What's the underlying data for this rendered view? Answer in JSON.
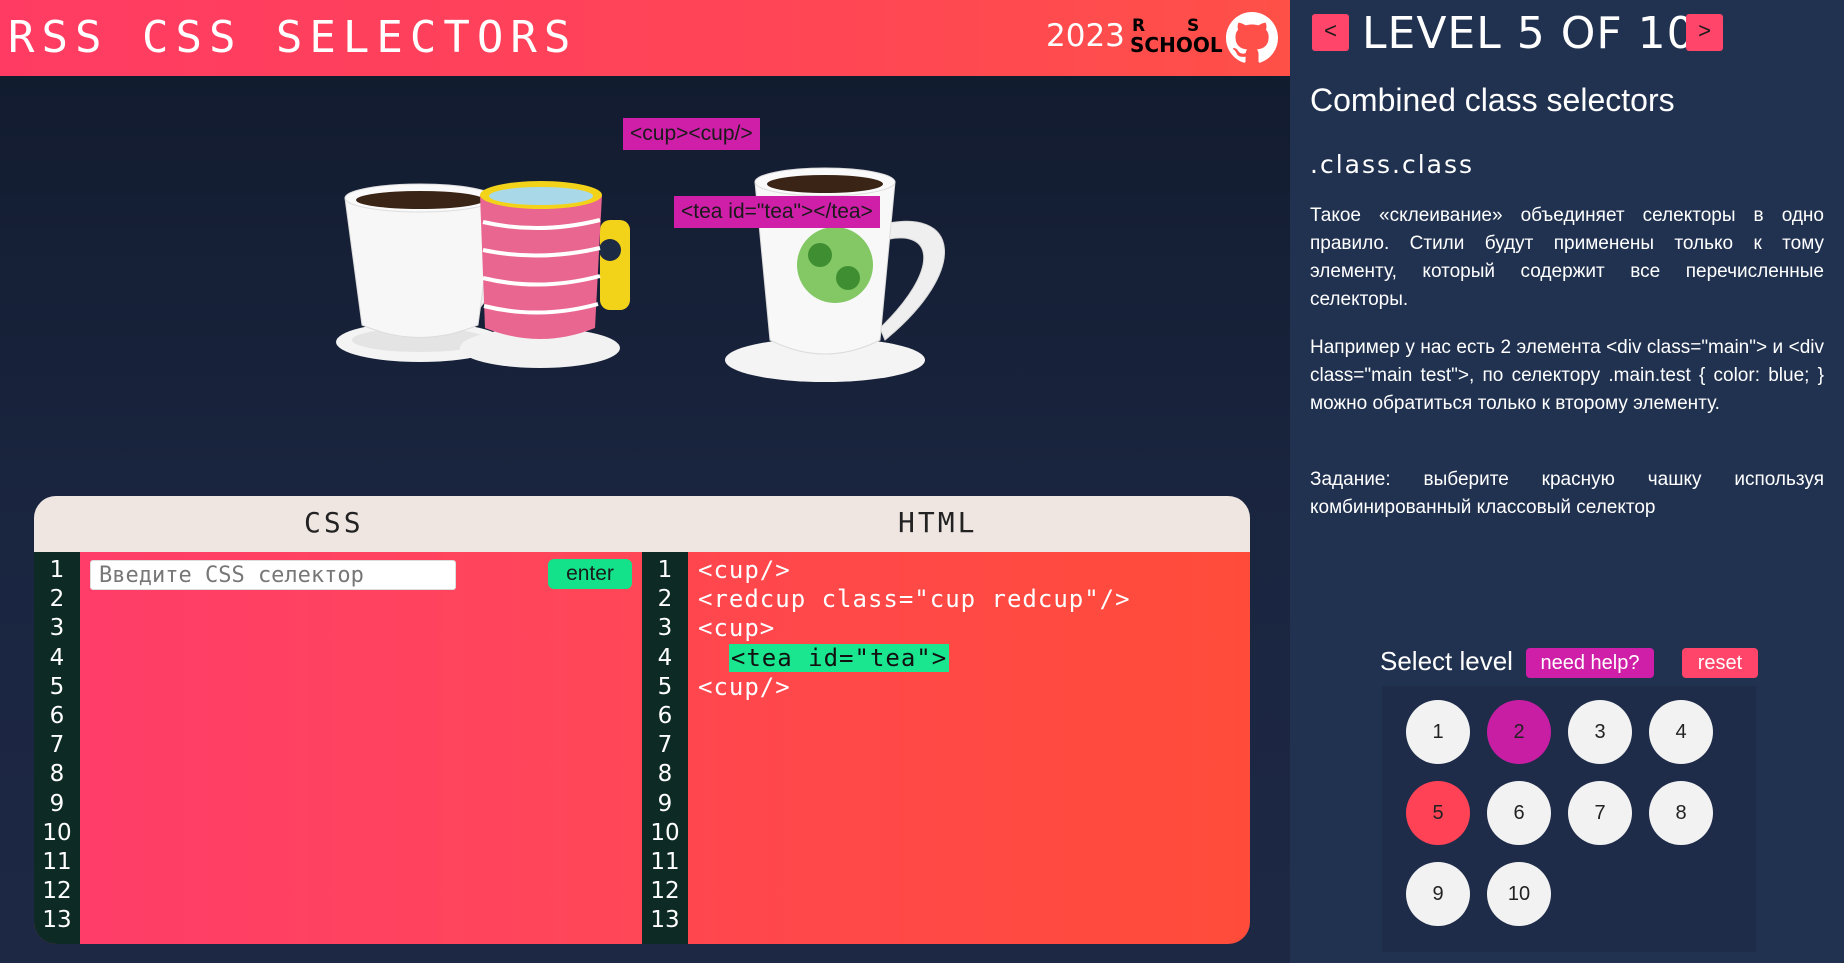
{
  "header": {
    "title": "RSS CSS SELECTORS",
    "year": "2023",
    "logo": {
      "top": "R S",
      "bottom": "SCHOOL"
    }
  },
  "scene": {
    "labels": [
      "<cup><cup/>",
      "<tea id=\"tea\"></tea>"
    ]
  },
  "editor": {
    "css_header": "CSS",
    "html_header": "HTML",
    "input_placeholder": "Введите CSS селектор",
    "enter_label": "enter",
    "line_numbers": [
      "1",
      "2",
      "3",
      "4",
      "5",
      "6",
      "7",
      "8",
      "9",
      "10",
      "11",
      "12",
      "13"
    ],
    "html_lines": [
      "<cup/>",
      "<redcup class=\"cup redcup\"/>",
      "<cup>",
      "<tea id=\"tea\">",
      "<cup/>"
    ]
  },
  "sidebar": {
    "prev_label": "<",
    "next_label": ">",
    "level_title": "LEVEL 5 OF 10",
    "selector_title": "Combined class selectors",
    "selector_syntax": ".class.class",
    "paragraphs": [
      "Такое «склеивание» объединяет селекторы в одно правило. Стили будут применены только к тому элементу, который содержит все перечисленные селекторы.",
      "Например у нас есть 2 элемента <div class=\"main\"> и <div class=\"main test\">, по селектору .main.test { color: blue; } можно обратиться только к второму элементу.",
      "Задание: выберите красную чашку используя комбинированный классовый селектор"
    ],
    "select_level_label": "Select level",
    "help_label": "need help?",
    "reset_label": "reset",
    "levels": [
      "1",
      "2",
      "3",
      "4",
      "5",
      "6",
      "7",
      "8",
      "9",
      "10"
    ],
    "completed_levels": [
      "2"
    ],
    "current_level": "5"
  },
  "colors": {
    "accent_red": "#ff4569",
    "completed": "#c81ea3",
    "highlight": "#1be690",
    "enter_green": "#14e28a"
  }
}
